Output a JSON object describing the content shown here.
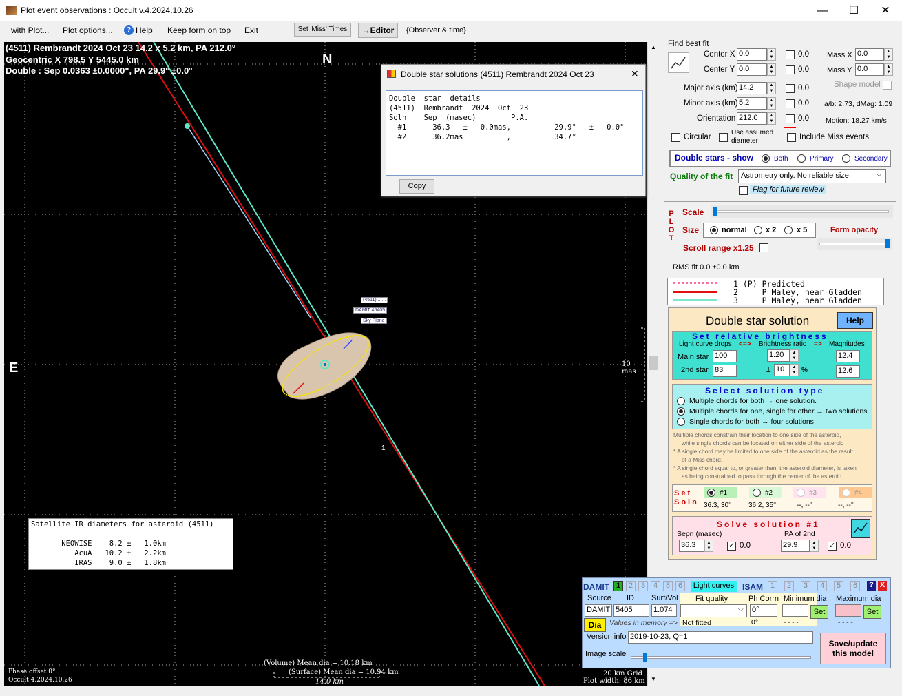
{
  "window": {
    "title": "Plot event observations : Occult v.4.2024.10.26",
    "min": "—",
    "max": "☐",
    "close": "✕"
  },
  "menu": {
    "with_plot": "with Plot...",
    "plot_options": "Plot options...",
    "help": "Help",
    "keep_on_top": "Keep form on top",
    "exit": "Exit",
    "set_miss": "Set 'Miss' Times",
    "editor": "→Editor",
    "observer_time": "{Observer & time}"
  },
  "plot": {
    "line1": "(4511) Rembrandt  2024 Oct 23   14.2 x 5.2 km, PA 212.0°",
    "line2": "Geocentric  X  798.5  Y 5445.0 km",
    "line3": "Double : Sep  0.0363 ±0.0000\", PA 29.9° ±0.0°",
    "north": "N",
    "east": "E",
    "scale_mas": "10 mas",
    "tag1": "(4511) ......",
    "tag2": "DAMIT #5405",
    "tag3": "Sky Plane",
    "chord_label": "1",
    "vol_dia": "(Volume) Mean dia = 10.18 km",
    "surf_dia": "(Surface) Mean dia = 10.94 km",
    "width_km": "14.0 km",
    "phase_offset": "Phase offset 0°",
    "version": "Occult 4.2024.10.26",
    "grid": "20 km Grid",
    "plot_width": "Plot width: 86 km"
  },
  "dialog": {
    "title": "Double star solutions (4511) Rembrandt 2024 Oct 23",
    "close": "✕",
    "lines": [
      "Double  star  details",
      "(4511)  Rembrandt  2024  Oct  23",
      "Soln    Sep  (masec)        P.A.",
      "  #1      36.3   ±   0.0mas,          29.9°   ±   0.0°",
      "  #2      36.2mas          ,          34.7°"
    ],
    "copy": "Copy"
  },
  "satellite": {
    "lines": [
      "Satellite IR diameters for asteroid (4511)",
      "",
      "       NEOWISE    8.2 ±   1.0km",
      "          AcuA   10.2 ±   2.2km",
      "          IRAS    9.0 ±   1.8km"
    ]
  },
  "fit": {
    "find_best_fit": "Find best fit",
    "center_x": "Center X",
    "center_y": "Center Y",
    "major": "Major axis (km)",
    "minor": "Minor axis (km)",
    "orientation": "Orientation",
    "cx_val": "0.0",
    "cy_val": "0.0",
    "major_val": "14.2",
    "minor_val": "5.2",
    "orient_val": "212.0",
    "cx_err": "0.0",
    "cy_err": "0.0",
    "major_err": "0.0",
    "minor_err": "0.0",
    "orient_err": "0.0",
    "mass_x": "Mass X",
    "mass_y": "Mass Y",
    "mass_x_val": "0.0",
    "mass_y_val": "0.0",
    "shape_model": "Shape model",
    "ab": "a/b: 2.73, dMag: 1.09",
    "motion": "Motion: 18.27 km/s",
    "circular": "Circular",
    "use_assumed": "Use assumed diameter",
    "include_miss": "Include Miss events"
  },
  "double_show": {
    "label": "Double stars - show",
    "both": "Both",
    "primary": "Primary",
    "secondary": "Secondary"
  },
  "quality": {
    "label": "Quality of the fit",
    "value": "Astrometry only. No reliable size",
    "flag": "Flag for future review"
  },
  "plotbox": {
    "vertical": [
      "P",
      "L",
      "O",
      "T"
    ],
    "scale": "Scale",
    "size": "Size",
    "normal": "normal",
    "x2": "x 2",
    "x5": "x 5",
    "form_opacity": "Form opacity",
    "scroll_range": "Scroll range x1.25"
  },
  "rms": "RMS fit 0.0 ±0.0 km",
  "legend": [
    {
      "num": "1",
      "code": "(P)",
      "name": "Predicted"
    },
    {
      "num": "2",
      "code": "P",
      "name": "Maley, near Gladden"
    },
    {
      "num": "3",
      "code": "P",
      "name": "Maley, near Gladden"
    }
  ],
  "dss": {
    "title": "Double star solution",
    "help": "Help",
    "relative": "Set relative brightness",
    "lc_drops": "Light curve drops",
    "arrow1": "<=>",
    "bright_ratio": "Brightness ratio",
    "arrow2": "=>",
    "magnitudes": "Magnitudes",
    "main_star": "Main star",
    "second_star": "2nd star",
    "main_drop": "100",
    "second_drop": "83",
    "ratio": "1.20",
    "pm": "±",
    "ratio_err": "10",
    "pct": "%",
    "mag1": "12.4",
    "mag2": "12.6",
    "select_type": "Select solution type",
    "opt1": "Multiple chords for both → one solution.",
    "opt2": "Multiple chords for one, single for other → two solutions",
    "opt3": "Single chords for both → four solutions",
    "notes": [
      "Multiple chords constrain their location to one side of the asteroid,",
      "while single chords can be located on either side of the asteroid",
      "* A single chord may be limited to one side of the asteroid as the result",
      "of a Miss chord.",
      "* A single chord equal to, or greater than, the asteroid diameter, is taken",
      "as being constrained to pass through the center of the asteroid."
    ],
    "set_soln": [
      "Set",
      "Soln"
    ],
    "s1": "#1",
    "s2": "#2",
    "s3": "#3",
    "s4": "#4",
    "s1v": "36.3, 30°",
    "s2v": "36.2, 35°",
    "s3v": "--, --°",
    "s4v": "--, --°",
    "solve": "Solve solution #1",
    "sepn": "Sepn (masec)",
    "pa2": "PA of 2nd",
    "sepn_val": "36.3",
    "sepn_err": "0.0",
    "pa_val": "29.9",
    "pa_err": "0.0"
  },
  "damit": {
    "damit": "DAMIT",
    "nums": [
      "1",
      "2",
      "3",
      "4",
      "5",
      "6"
    ],
    "light_curves": "Light curves",
    "isam": "ISAM",
    "isam_nums": [
      "1",
      "2",
      "3",
      "4",
      "5",
      "6"
    ],
    "q": "?",
    "x": "X",
    "source": "Source",
    "id": "ID",
    "surf_vol": "Surf/Vol",
    "fit_quality": "Fit quality",
    "ph_corr": "Ph Corrn",
    "min_dia": "Minimum dia",
    "max_dia": "Maximum dia",
    "source_val": "DAMIT",
    "id_val": "5405",
    "surf_val": "1.074",
    "ph_val": "0°",
    "dia": "Dia",
    "values_mem": "Values in memory =>",
    "not_fitted": "Not fitted",
    "ph_mem": "0°",
    "min_mem": "- - - -",
    "max_mem": "- - - -",
    "set": "Set",
    "version_info": "Version info",
    "version_val": "2019-10-23, Q=1",
    "image_scale": "Image scale",
    "save": "Save/update this model"
  }
}
